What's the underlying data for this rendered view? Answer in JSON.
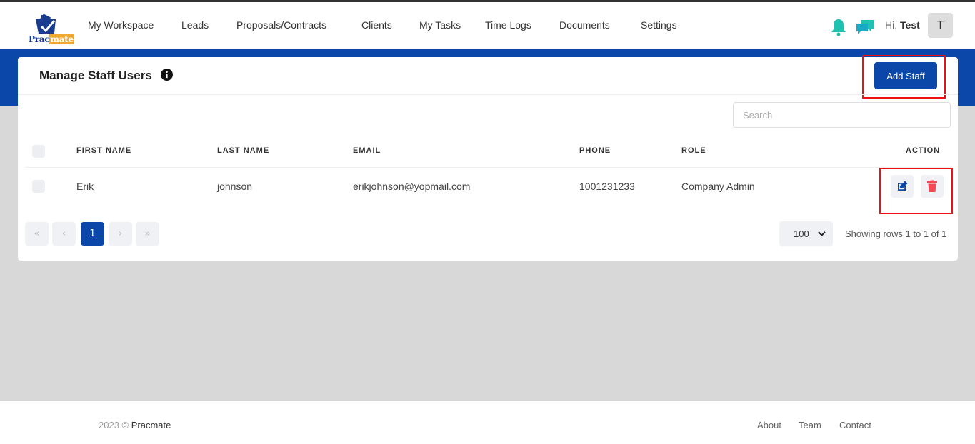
{
  "brand": {
    "part1": "Prac",
    "part2": "mate"
  },
  "nav": [
    {
      "label": "My Workspace"
    },
    {
      "label": "Leads"
    },
    {
      "label": "Proposals/Contracts"
    },
    {
      "label": "Clients"
    },
    {
      "label": "My Tasks"
    },
    {
      "label": "Time Logs"
    },
    {
      "label": "Documents"
    },
    {
      "label": "Settings"
    }
  ],
  "user": {
    "greeting": "Hi,",
    "name": "Test",
    "initial": "T"
  },
  "icons": {
    "bell": "bell-icon",
    "chat": "chat-icon",
    "info": "info-icon",
    "edit": "edit-icon",
    "delete": "trash-icon"
  },
  "colors": {
    "primary": "#0a47a8",
    "notify": "#1fc2b0",
    "danger": "#f04a55",
    "highlight": "#e11111"
  },
  "page": {
    "title": "Manage Staff Users",
    "add_button": "Add Staff",
    "search_placeholder": "Search"
  },
  "table": {
    "columns": [
      "FIRST NAME",
      "LAST NAME",
      "EMAIL",
      "PHONE",
      "ROLE",
      "ACTION"
    ],
    "rows": [
      {
        "first_name": "Erik",
        "last_name": "johnson",
        "email": "erikjohnson@yopmail.com",
        "phone": "1001231233",
        "role": "Company Admin"
      }
    ]
  },
  "pagination": {
    "current_page": "1",
    "per_page": "100",
    "info": "Showing rows 1 to  1 of 1"
  },
  "footer": {
    "year": "2023 ©",
    "brand": "Pracmate",
    "links": [
      "About",
      "Team",
      "Contact"
    ]
  }
}
